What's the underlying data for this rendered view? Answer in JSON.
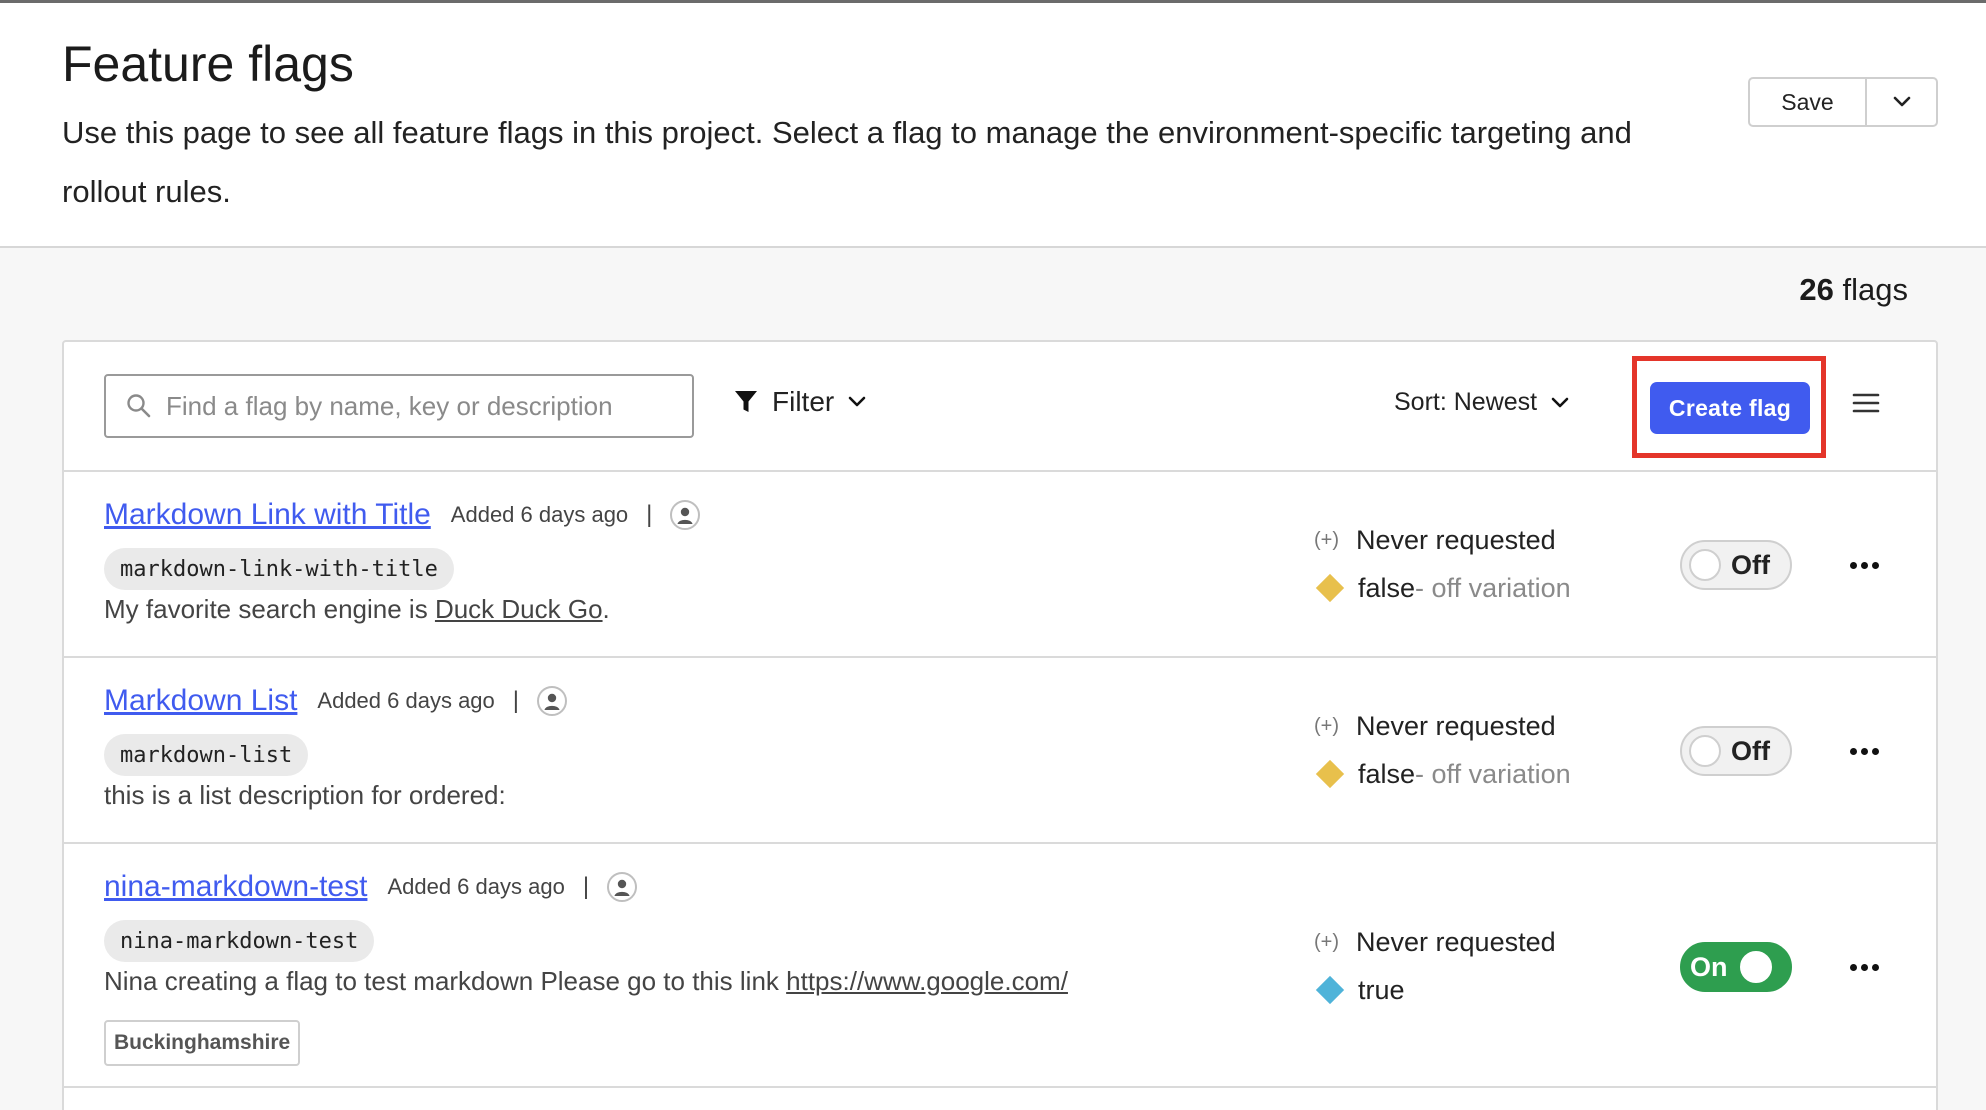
{
  "header": {
    "title": "Feature flags",
    "description": "Use this page to see all feature flags in this project. Select a flag to manage the environment-specific targeting and rollout rules.",
    "save_label": "Save"
  },
  "flag_count": {
    "number": "26",
    "label": "flags"
  },
  "toolbar": {
    "search_placeholder": "Find a flag by name, key or description",
    "filter_label": "Filter",
    "sort_label": "Sort: Newest",
    "create_label": "Create flag"
  },
  "flags": [
    {
      "name": "Markdown Link with Title",
      "added": "Added 6 days ago",
      "key": "markdown-link-with-title",
      "desc_prefix": "My favorite search engine is ",
      "desc_link": "Duck Duck Go",
      "desc_suffix": ".",
      "requests_icon": "(+)",
      "requests": "Never requested",
      "value": "false",
      "variation": " - off variation",
      "variation_color": "#e8c04c",
      "toggle": "Off"
    },
    {
      "name": "Markdown List",
      "added": "Added 6 days ago",
      "key": "markdown-list",
      "desc_prefix": "this is a list description for ordered:",
      "requests_icon": "(+)",
      "requests": "Never requested",
      "value": "false",
      "variation": " - off variation",
      "variation_color": "#e8c04c",
      "toggle": "Off"
    },
    {
      "name": "nina-markdown-test",
      "added": "Added 6 days ago",
      "key": "nina-markdown-test",
      "desc_prefix": "Nina creating a flag to test markdown Please go to this link ",
      "desc_link": "https://www.google.com/",
      "tag": "Buckinghamshire",
      "requests_icon": "(+)",
      "requests": "Never requested",
      "value": "true",
      "variation_color": "#4fb3d9",
      "toggle": "On"
    }
  ],
  "icons": {
    "search": "search-icon",
    "filter": "filter-icon",
    "chevron": "chevron-down-icon",
    "menu": "menu-icon",
    "avatar": "user-icon",
    "more": "more-icon"
  },
  "colors": {
    "accent": "#405bef",
    "highlight": "#e4352a",
    "on": "#2e9e4f"
  }
}
